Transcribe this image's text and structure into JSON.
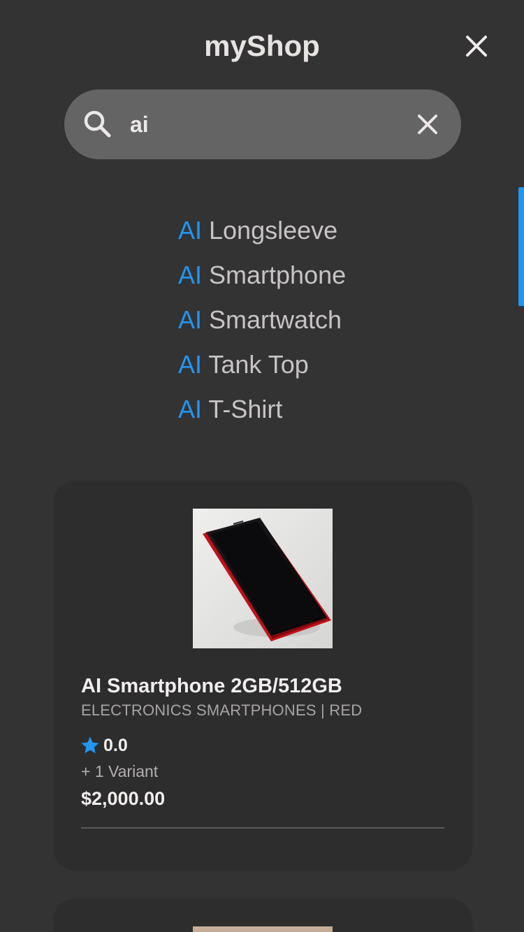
{
  "header": {
    "title": "myShop",
    "close_icon": "close-icon"
  },
  "search": {
    "value": "ai",
    "placeholder": "",
    "search_icon": "search-icon",
    "clear_icon": "close-icon"
  },
  "suggestions": [
    {
      "highlight": "AI",
      "rest": " Longsleeve"
    },
    {
      "highlight": "AI",
      "rest": " Smartphone"
    },
    {
      "highlight": "AI",
      "rest": " Smartwatch"
    },
    {
      "highlight": "AI",
      "rest": " Tank Top"
    },
    {
      "highlight": "AI",
      "rest": " T-Shirt"
    }
  ],
  "products": [
    {
      "name": "AI Smartphone 2GB/512GB",
      "category": "ELECTRONICS SMARTPHONES | RED",
      "rating": "0.0",
      "variants": "+ 1 Variant",
      "price": "$2,000.00",
      "image_icon": "smartphone-image"
    }
  ],
  "colors": {
    "background": "#333333",
    "accent": "#2196f3",
    "card": "#2d2d2d",
    "search_bar": "#646464"
  }
}
